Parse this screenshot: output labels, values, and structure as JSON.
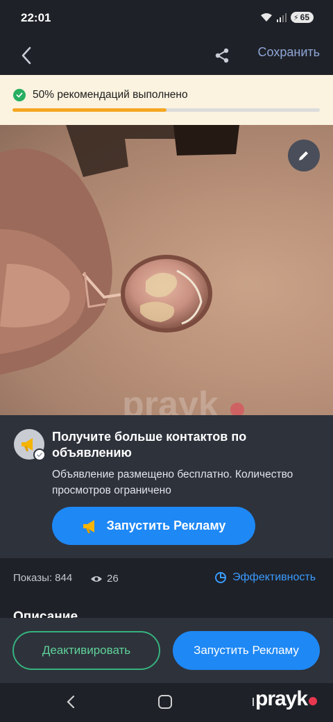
{
  "status_bar": {
    "time": "22:01",
    "battery": "65"
  },
  "app_bar": {
    "save_label": "Сохранить"
  },
  "progress": {
    "text": "50% рекомендаций выполнено",
    "percent": 50
  },
  "photo": {
    "watermark": "prayk"
  },
  "promo": {
    "title": "Получите больше контактов по объявлению",
    "description": "Объявление размещено бесплатно. Количество просмотров ограничено",
    "cta_label": "Запустить Рекламу"
  },
  "stats": {
    "views_label": "Показы: 844",
    "eye_count": "26",
    "efficiency_label": "Эффективность"
  },
  "section": {
    "description_heading": "Описание"
  },
  "bottom_actions": {
    "deactivate_label": "Деактивировать",
    "launch_label": "Запустить Рекламу"
  },
  "brand": {
    "logo_text": "prayk"
  },
  "colors": {
    "accent_blue": "#1e88f5",
    "success_green": "#36b37e",
    "progress_orange": "#f5a623",
    "brand_red": "#e8384f"
  }
}
